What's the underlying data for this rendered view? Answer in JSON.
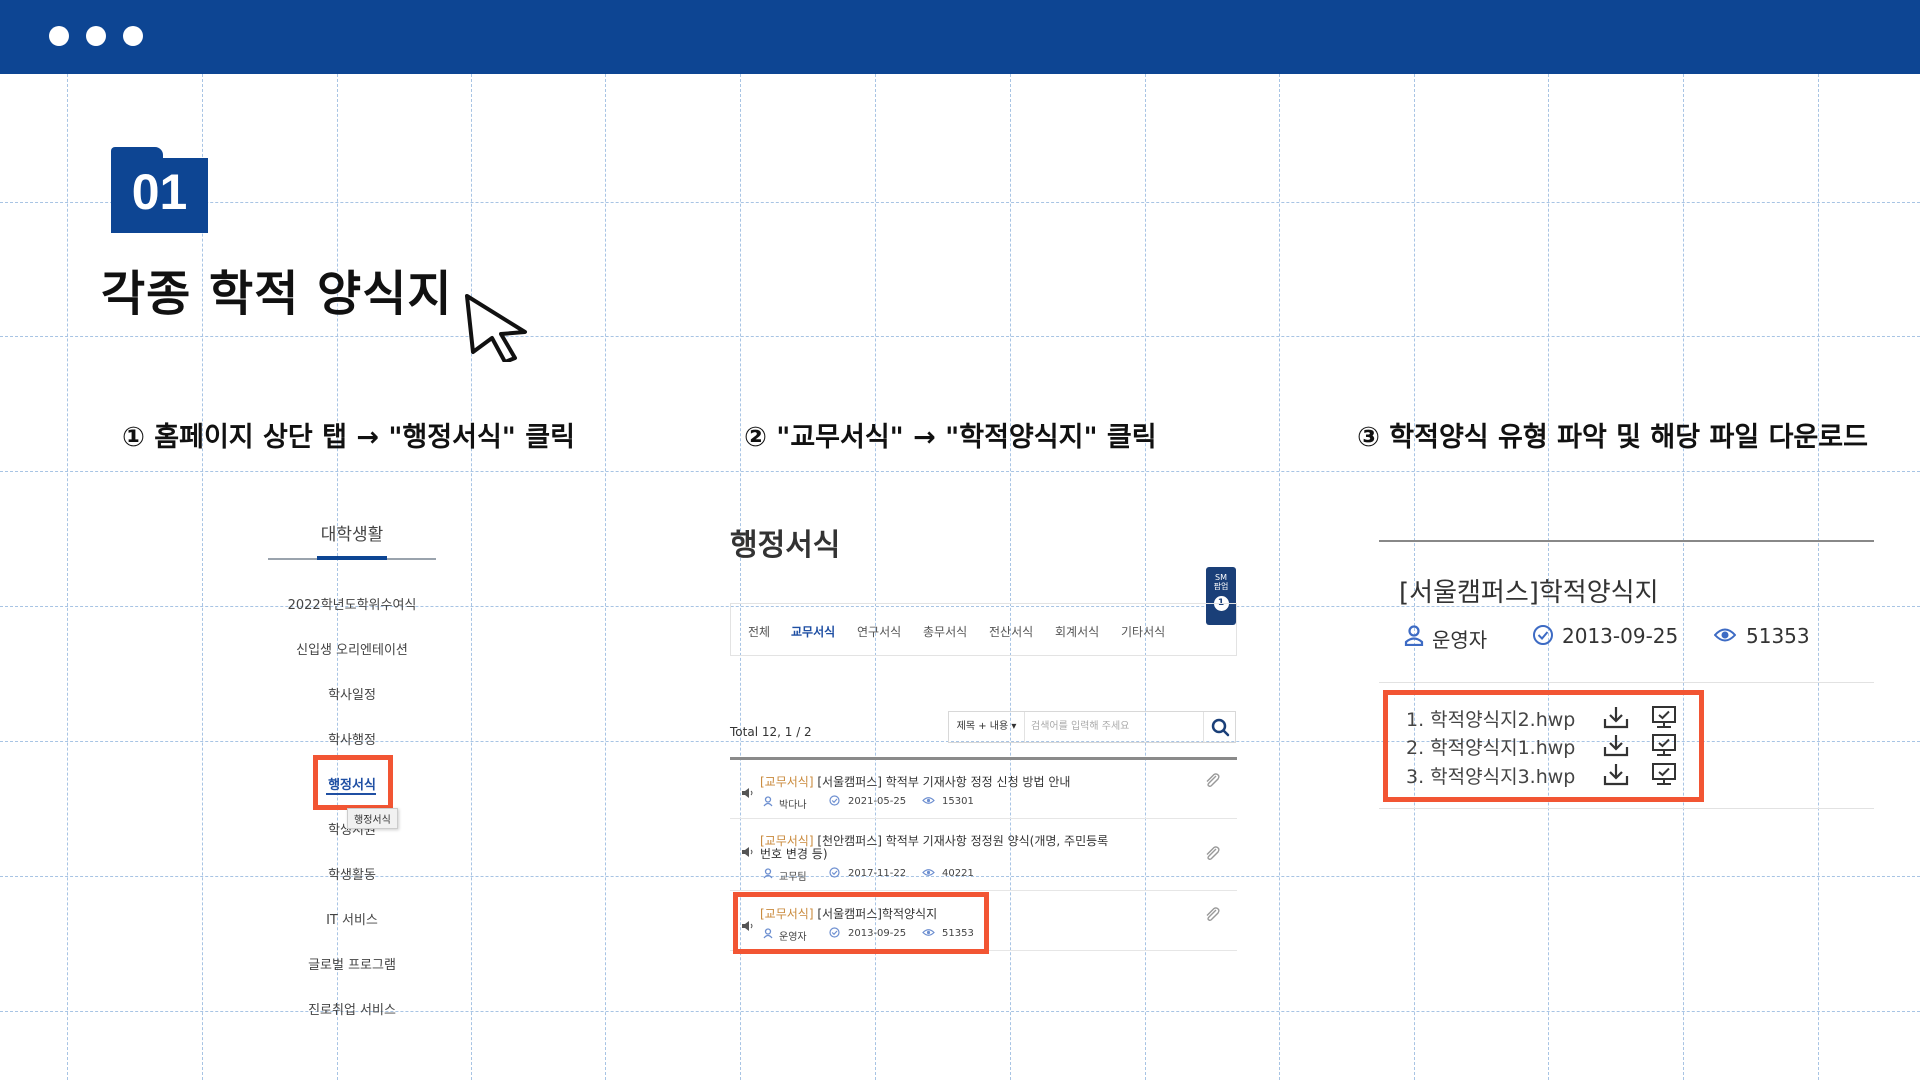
{
  "header": {
    "window_controls": [
      "dot",
      "dot",
      "dot"
    ]
  },
  "section": {
    "number": "01",
    "title": "각종 학적 양식지"
  },
  "steps": [
    "① 홈페이지 상단 탭 → \"행정서식\" 클릭",
    "② \"교무서식\" → \"학적양식지\" 클릭",
    "③ 학적양식 유형 파악 및 해당 파일 다운로드"
  ],
  "panel1": {
    "heading": "대학생활",
    "menu": [
      "2022학년도학위수여식",
      "신입생 오리엔테이션",
      "학사일정",
      "학사행정",
      "행정서식",
      "학생지원",
      "학생활동",
      "IT 서비스",
      "글로벌 프로그램",
      "진로취업 서비스"
    ],
    "active_index": 4,
    "tooltip": "행정서식"
  },
  "panel2": {
    "title": "행정서식",
    "badge": {
      "label_line1": "SM",
      "label_line2": "팝업",
      "count": "1"
    },
    "tabs": [
      "전체",
      "교무서식",
      "연구서식",
      "총무서식",
      "전산서식",
      "회계서식",
      "기타서식"
    ],
    "active_tab": "교무서식",
    "total": "Total 12, 1 / 2",
    "search": {
      "select": "제목 + 내용 ▾",
      "placeholder": "검색어를 입력해 주세요"
    },
    "posts": [
      {
        "tag": "[교무서식]",
        "title": "[서울캠퍼스] 학적부 기재사항 정정 신청 방법 안내",
        "author": "박다나",
        "date": "2021-05-25",
        "views": "15301"
      },
      {
        "tag": "[교무서식]",
        "title": "[천안캠퍼스] 학적부 기재사항 정정원 양식(개명, 주민등록",
        "title_line2": "번호 변경 등)",
        "author": "교무팀",
        "date": "2017-11-22",
        "views": "40221"
      },
      {
        "tag": "[교무서식]",
        "title": "[서울캠퍼스]학적양식지",
        "author": "운영자",
        "date": "2013-09-25",
        "views": "51353"
      }
    ]
  },
  "panel3": {
    "title": "[서울캠퍼스]학적양식지",
    "author": "운영자",
    "date": "2013-09-25",
    "views": "51353",
    "files": [
      "1. 학적양식지2.hwp",
      "2. 학적양식지1.hwp",
      "3. 학적양식지3.hwp"
    ]
  },
  "colors": {
    "brand": "#0d4593",
    "highlight": "#f25533",
    "tag": "#c9893b",
    "grid": "#a8c4e4"
  }
}
